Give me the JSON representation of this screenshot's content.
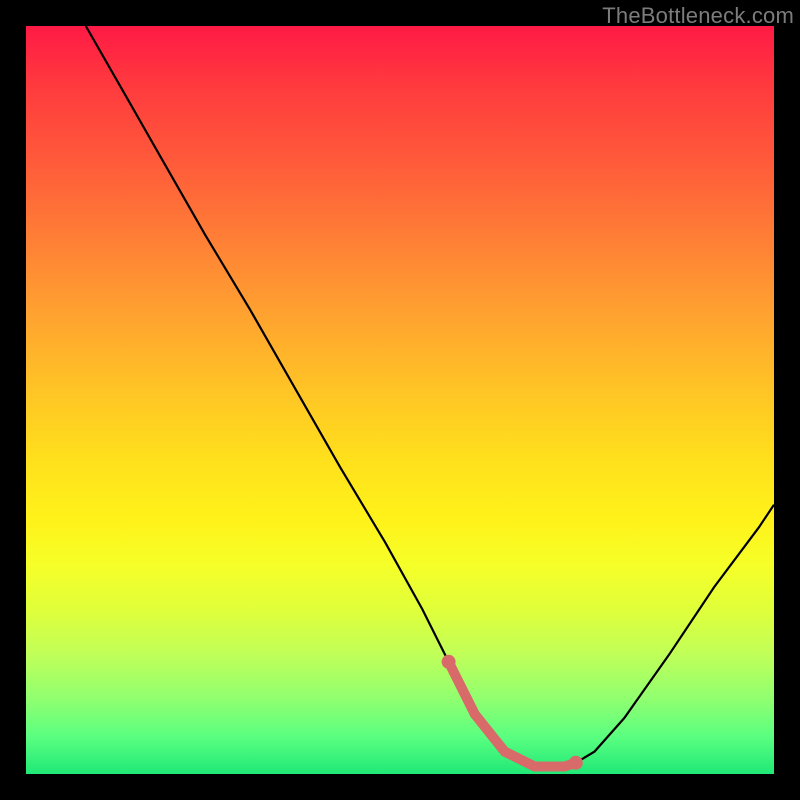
{
  "watermark": "TheBottleneck.com",
  "chart_data": {
    "type": "line",
    "title": "",
    "xlabel": "",
    "ylabel": "",
    "xlim": [
      0,
      100
    ],
    "ylim": [
      0,
      100
    ],
    "series": [
      {
        "name": "bottleneck-curve",
        "color": "#000000",
        "x": [
          8,
          12,
          18,
          24,
          30,
          36,
          42,
          48,
          53,
          56.5,
          58,
          60,
          64,
          68,
          72,
          73.5,
          76,
          80,
          86,
          92,
          98,
          100
        ],
        "values": [
          100,
          93,
          82.5,
          72,
          62,
          51.5,
          41,
          31,
          22,
          15,
          12,
          8,
          3,
          1,
          1,
          1.5,
          3,
          7.5,
          16,
          25,
          33,
          36
        ]
      },
      {
        "name": "highlight-segment",
        "color": "#d86a6a",
        "x": [
          56.5,
          58,
          60,
          64,
          68,
          72,
          73.5
        ],
        "values": [
          15,
          12,
          8,
          3,
          1,
          1,
          1.5
        ]
      }
    ],
    "markers": [
      {
        "name": "highlight-start",
        "x": 56.5,
        "y": 15,
        "color": "#d86a6a"
      },
      {
        "name": "highlight-end",
        "x": 73.5,
        "y": 1.5,
        "color": "#d86a6a"
      }
    ]
  }
}
